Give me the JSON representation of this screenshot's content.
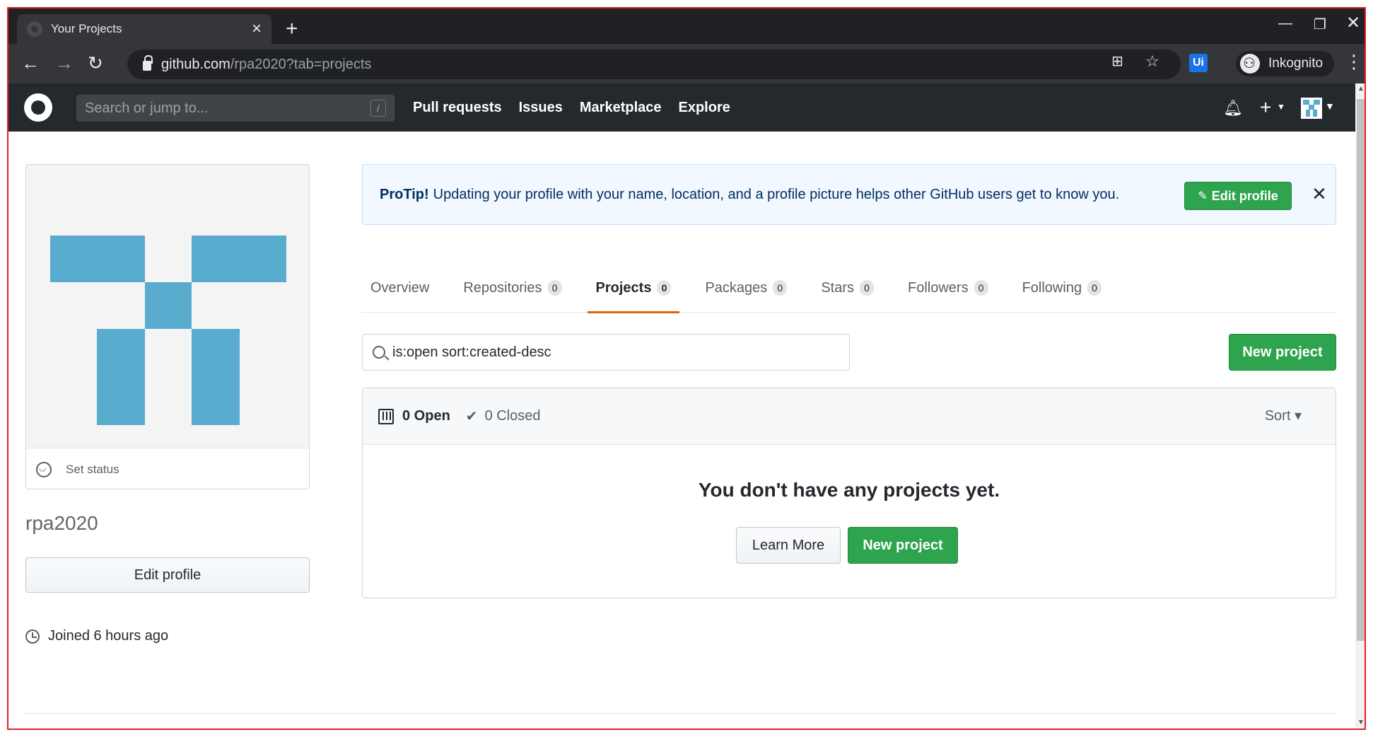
{
  "browser": {
    "tab_title": "Your Projects",
    "new_tab": "+",
    "url_domain": "github.com",
    "url_path": "/rpa2020?tab=projects",
    "extension_label": "Ui",
    "profile_label": "Inkognito",
    "icons": [
      "back-icon",
      "forward-icon",
      "reload-icon",
      "lock-icon",
      "translate-icon",
      "star-icon",
      "menu-dots-icon",
      "minimize-icon",
      "restore-icon",
      "close-icon"
    ]
  },
  "gh_header": {
    "search_placeholder": "Search or jump to...",
    "search_shortcut": "/",
    "nav": [
      "Pull requests",
      "Issues",
      "Marketplace",
      "Explore"
    ]
  },
  "profile": {
    "set_status": "Set status",
    "username": "rpa2020",
    "edit_profile": "Edit profile",
    "joined": "Joined 6 hours ago"
  },
  "protip": {
    "label": "ProTip!",
    "message": "Updating your profile with your name, location, and a profile picture helps other GitHub users get to know you.",
    "button": "Edit profile"
  },
  "tabs": [
    {
      "label": "Overview",
      "count": null
    },
    {
      "label": "Repositories",
      "count": "0"
    },
    {
      "label": "Projects",
      "count": "0"
    },
    {
      "label": "Packages",
      "count": "0"
    },
    {
      "label": "Stars",
      "count": "0"
    },
    {
      "label": "Followers",
      "count": "0"
    },
    {
      "label": "Following",
      "count": "0"
    }
  ],
  "projects": {
    "search_value": "is:open sort:created-desc",
    "new_project": "New project",
    "open": "0 Open",
    "closed": "0 Closed",
    "sort": "Sort ▾",
    "empty_title": "You don't have any projects yet.",
    "learn_more": "Learn More",
    "new_project_empty": "New project"
  },
  "colors": {
    "accent_green": "#2ea44f",
    "tab_underline": "#e36209",
    "identicon": "#5aaccf",
    "header_bg": "#24292e"
  }
}
